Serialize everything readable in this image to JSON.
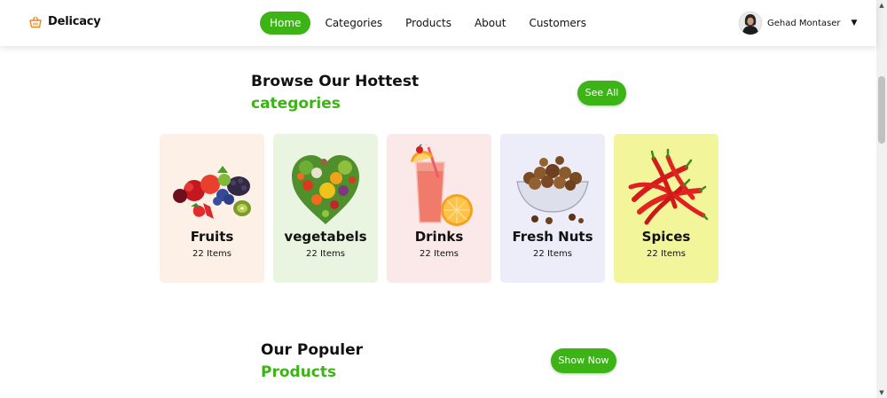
{
  "brand": {
    "name": "Delicacy",
    "icon": "basket-icon",
    "accent": "#e8891e"
  },
  "nav": {
    "items": [
      {
        "label": "Home",
        "active": true
      },
      {
        "label": "Categories",
        "active": false
      },
      {
        "label": "Products",
        "active": false
      },
      {
        "label": "About",
        "active": false
      },
      {
        "label": "Customers",
        "active": false
      }
    ]
  },
  "user": {
    "name": "Gehad Montaser",
    "dropdown_icon": "caret-down-icon"
  },
  "categories_section": {
    "title": "Browse Our Hottest",
    "subtitle": "categories",
    "button": "See All"
  },
  "categories": [
    {
      "name": "Fruits",
      "count": "22 Items",
      "bg": "#fdf1e7",
      "icon": "fruits-image"
    },
    {
      "name": "vegetabels",
      "count": "22 Items",
      "bg": "#e9f4e1",
      "icon": "vegetables-image"
    },
    {
      "name": "Drinks",
      "count": "22 Items",
      "bg": "#fbe8e8",
      "icon": "drinks-image"
    },
    {
      "name": "Fresh Nuts",
      "count": "22 Items",
      "bg": "#ecedf8",
      "icon": "nuts-image"
    },
    {
      "name": "Spices",
      "count": "22 Items",
      "bg": "#f3f59a",
      "icon": "chili-image"
    }
  ],
  "products_section": {
    "title": "Our Populer",
    "subtitle": "Products",
    "button": "Show Now"
  },
  "colors": {
    "primary": "#3cb416",
    "text": "#111111"
  }
}
